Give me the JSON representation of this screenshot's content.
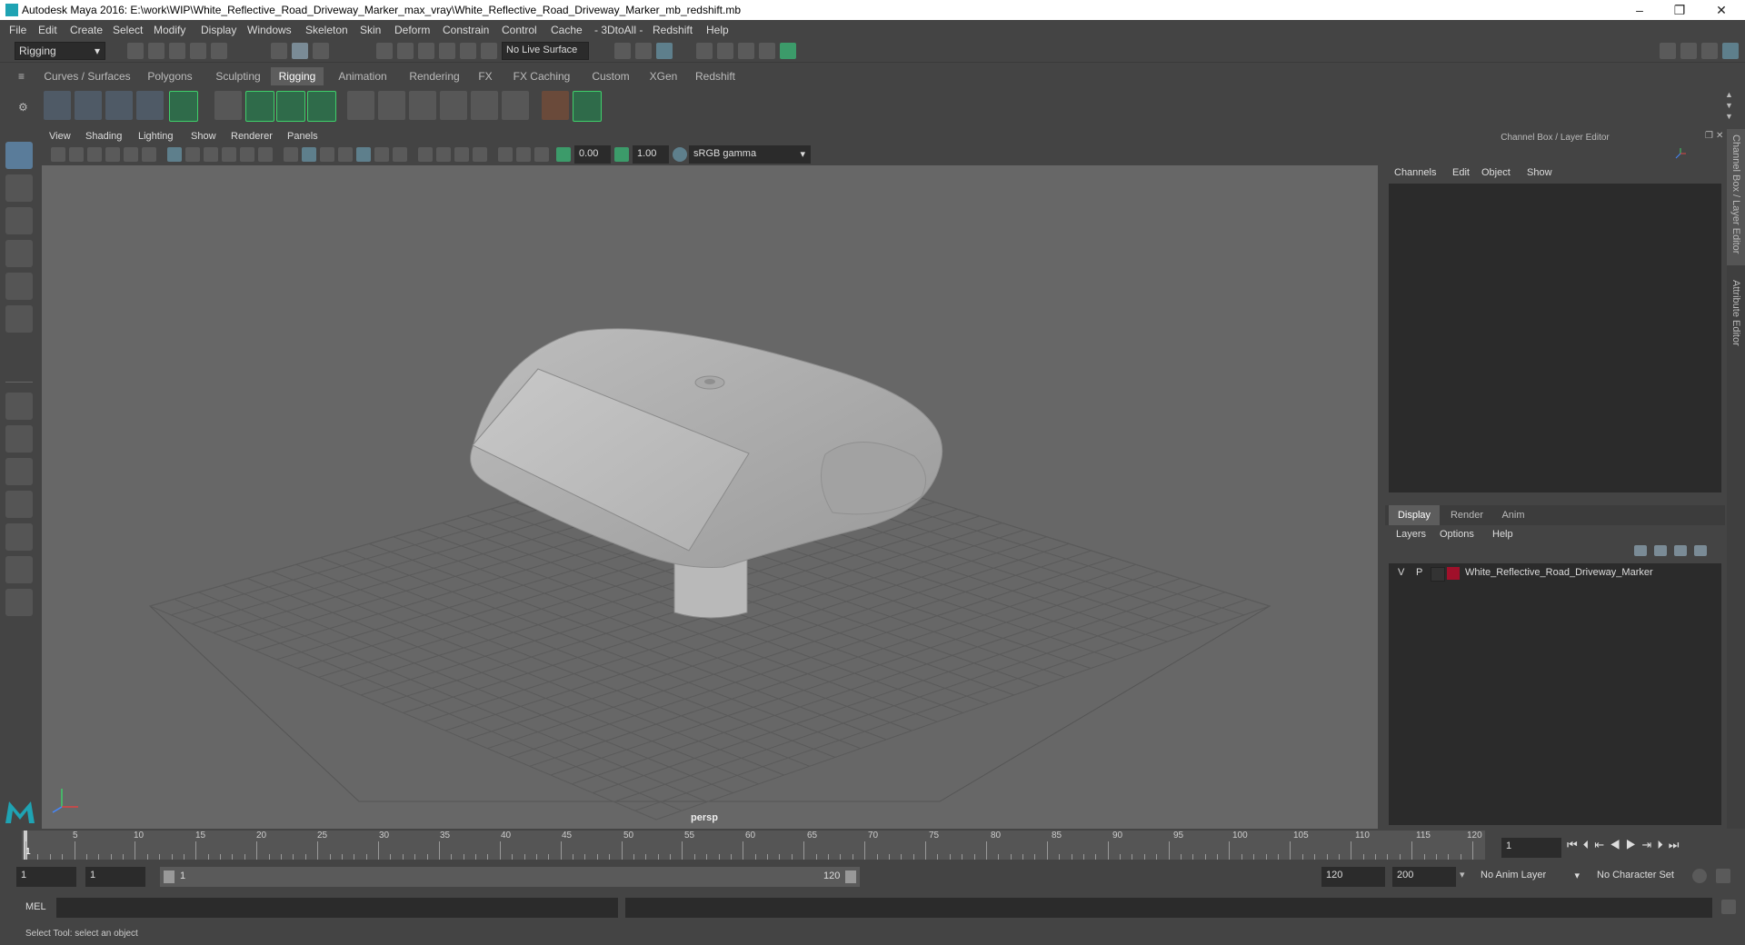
{
  "window": {
    "title": "Autodesk Maya 2016: E:\\work\\WIP\\White_Reflective_Road_Driveway_Marker_max_vray\\White_Reflective_Road_Driveway_Marker_mb_redshift.mb",
    "minimize": "–",
    "restore": "❐",
    "close": "✕"
  },
  "menus": [
    "File",
    "Edit",
    "Create",
    "Select",
    "Modify",
    "Display",
    "Windows",
    "Skeleton",
    "Skin",
    "Deform",
    "Constrain",
    "Control",
    "Cache",
    "- 3DtoAll -",
    "Redshift",
    "Help"
  ],
  "statusline": {
    "menuset": "Rigging",
    "live_surface": "No Live Surface"
  },
  "shelf_tabs": [
    "Curves / Surfaces",
    "Polygons",
    "Sculpting",
    "Rigging",
    "Animation",
    "Rendering",
    "FX",
    "FX Caching",
    "Custom",
    "XGen",
    "Redshift"
  ],
  "active_shelf": "Rigging",
  "viewport": {
    "menus": [
      "View",
      "Shading",
      "Lighting",
      "Show",
      "Renderer",
      "Panels"
    ],
    "exposure": "0.00",
    "gamma": "1.00",
    "color_space": "sRGB gamma",
    "camera_label": "persp"
  },
  "channel_box": {
    "title": "Channel Box / Layer Editor",
    "menus": [
      "Channels",
      "Edit",
      "Object",
      "Show"
    ],
    "layer_tabs": [
      "Display",
      "Render",
      "Anim"
    ],
    "active_layer_tab": "Display",
    "layer_menus": [
      "Layers",
      "Options",
      "Help"
    ],
    "layers": [
      {
        "visible": "V",
        "playback": "P",
        "name": "White_Reflective_Road_Driveway_Marker",
        "color": "#a0102a"
      }
    ]
  },
  "side_tabs": [
    "Channel Box / Layer Editor",
    "Attribute Editor"
  ],
  "timeline": {
    "ticks": [
      "1",
      "5",
      "10",
      "15",
      "20",
      "25",
      "30",
      "35",
      "40",
      "45",
      "50",
      "55",
      "60",
      "65",
      "70",
      "75",
      "80",
      "85",
      "90",
      "95",
      "100",
      "105",
      "110",
      "115",
      "120"
    ],
    "current_frame": "1"
  },
  "range": {
    "start": "1",
    "playback_start": "1",
    "slider_start": "1",
    "slider_end": "120",
    "playback_end": "120",
    "end": "200",
    "anim_layer": "No Anim Layer",
    "character_set": "No Character Set"
  },
  "command": {
    "label": "MEL"
  },
  "help_line": "Select Tool: select an object"
}
